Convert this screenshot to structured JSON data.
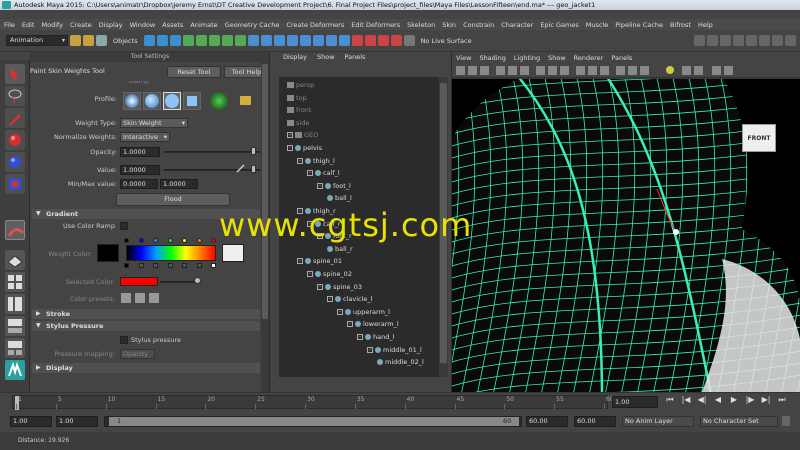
{
  "window": {
    "title": "Autodesk Maya 2015: C:\\Users\\animatr\\Dropbox\\Jeremy Ernst\\DT Creative Development Project\\6. Final Project Files\\project_files\\Maya Files\\LessonFifteen\\end.ma*    ---    geo_jacket1"
  },
  "menu": [
    "File",
    "Edit",
    "Modify",
    "Create",
    "Display",
    "Window",
    "Assets",
    "Animate",
    "Geometry Cache",
    "Create Deformers",
    "Edit Deformers",
    "Skeleton",
    "Skin",
    "Constrain",
    "Character",
    "Epic Games",
    "Muscle",
    "Pipeline Cache",
    "Bifrost",
    "Help"
  ],
  "shelf": {
    "mode": "Animation",
    "objects_label": "Objects",
    "live_surface": "No Live Surface"
  },
  "tool_settings": {
    "header": "Tool Settings",
    "tool_name": "Paint Skin Weights Tool",
    "reset_label": "Reset Tool",
    "help_label": "Tool Help",
    "partial_label": "Stamp",
    "profile_label": "Profile:",
    "weight_type_label": "Weight Type:",
    "weight_type_value": "Skin Weight",
    "normalize_label": "Normalize Weights:",
    "normalize_value": "Interactive",
    "opacity_label": "Opacity:",
    "opacity_value": "1.0000",
    "value_label": "Value:",
    "value_value": "1.0000",
    "minmax_label": "Min/Max value:",
    "min_value": "0.0000",
    "max_value": "1.0000",
    "flood_label": "Flood",
    "gradient_section": "Gradient",
    "use_color_ramp": "Use Color Ramp",
    "weight_color_label": "Weight Color:",
    "selected_color_label": "Selected Color:",
    "color_presets_label": "Color presets:",
    "stroke_section": "Stroke",
    "stylus_section": "Stylus Pressure",
    "stylus_checkbox": "Stylus pressure",
    "pressure_mapping_label": "Pressure mapping:",
    "pressure_mapping_value": "Opacity",
    "display_section": "Display",
    "opacity_level": 0.95,
    "value_level": 0.95
  },
  "outliner": {
    "menu": [
      "Display",
      "Show",
      "Panels"
    ],
    "items": [
      "persp",
      "top",
      "front",
      "side",
      "GEO",
      "pelvis",
      "thigh_l",
      "calf_l",
      "foot_l",
      "ball_l",
      "thigh_r",
      "calf_r",
      "foot_r",
      "ball_r",
      "spine_01",
      "spine_02",
      "spine_03",
      "clavicle_l",
      "upperarm_l",
      "lowerarm_l",
      "hand_l",
      "middle_01_l",
      "middle_02_l"
    ]
  },
  "viewport": {
    "menu": [
      "View",
      "Shading",
      "Lighting",
      "Show",
      "Renderer",
      "Panels"
    ],
    "viewcube_label": "FRONT",
    "watermark": "www.cgtsj.com"
  },
  "timeline": {
    "ticks": [
      "1",
      "5",
      "10",
      "15",
      "20",
      "25",
      "30",
      "35",
      "40",
      "45",
      "50",
      "55",
      "60"
    ],
    "current_frame": "1.00"
  },
  "range": {
    "start": "1.00",
    "inner_start": "1.00",
    "range_start": "1",
    "range_end": "60",
    "inner_end": "60.00",
    "end": "60.00",
    "anim_layer": "No Anim Layer",
    "char_set": "No Character Set"
  },
  "status": {
    "distance": "Distance: 19.926"
  },
  "colors": {
    "ramp": [
      "#000000",
      "#0000ff",
      "#00a0ff",
      "#00ff00",
      "#ffff00",
      "#ff8000",
      "#ff0000"
    ],
    "selected_color": "#ff0000",
    "wire": "#39f0b0",
    "watermark": "#e8e200"
  }
}
